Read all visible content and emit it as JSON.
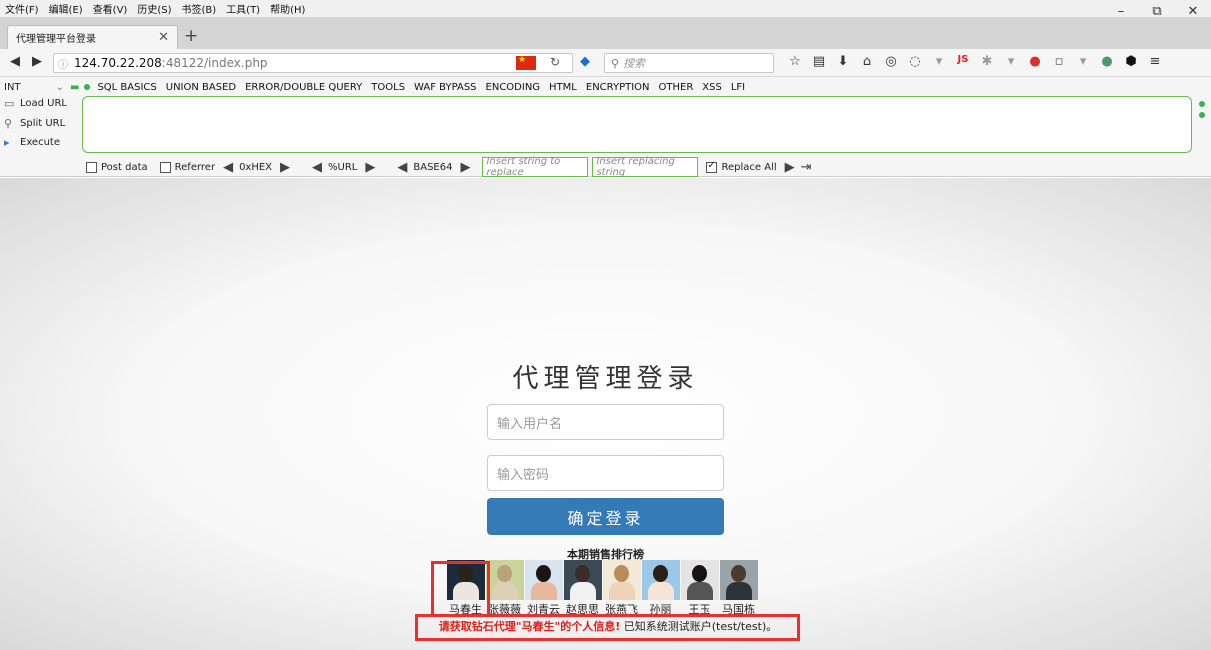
{
  "menubar": {
    "items": [
      "文件(F)",
      "编辑(E)",
      "查看(V)",
      "历史(S)",
      "书签(B)",
      "工具(T)",
      "帮助(H)"
    ]
  },
  "window_controls": [
    "–",
    "⧉",
    "✕"
  ],
  "tab": {
    "title": "代理管理平台登录",
    "close": "✕",
    "new_tab": "+"
  },
  "nav": {
    "url_host": "124.70.22.208",
    "url_path": ":48122/index.php",
    "search_placeholder": "搜索"
  },
  "hackbar": {
    "select_value": "INT",
    "menu_items": [
      "SQL BASICS",
      "UNION BASED",
      "ERROR/DOUBLE QUERY",
      "TOOLS",
      "WAF BYPASS",
      "ENCODING",
      "HTML",
      "ENCRYPTION",
      "OTHER",
      "XSS",
      "LFI"
    ],
    "load_url": "Load URL",
    "split_url": "Split URL",
    "execute": "Execute",
    "post_data": "Post data",
    "referrer": "Referrer",
    "hex": "0xHEX",
    "url": "%URL",
    "base64": "BASE64",
    "replace_input_placeholder": "Insert string to replace",
    "replacing_input_placeholder": "Insert replacing string",
    "replace_all": "Replace All"
  },
  "login": {
    "title": "代理管理登录",
    "username_placeholder": "输入用户名",
    "password_placeholder": "输入密码",
    "submit": "确定登录"
  },
  "ranking": {
    "title": "本期销售排行榜",
    "people": [
      {
        "name": "马春生",
        "bg": "#1e2a3a",
        "head": "#2b2220",
        "body": "#ece6e0"
      },
      {
        "name": "张薇薇",
        "bg": "#c9d39a",
        "head": "#b9a37e",
        "body": "#d9d2b6"
      },
      {
        "name": "刘青云",
        "bg": "#d7e3ee",
        "head": "#1b1614",
        "body": "#e7b89b"
      },
      {
        "name": "赵思思",
        "bg": "#3c4a56",
        "head": "#3a2c28",
        "body": "#f1f1f1"
      },
      {
        "name": "张燕飞",
        "bg": "#f2ead6",
        "head": "#b88c5a",
        "body": "#efd3b8"
      },
      {
        "name": "孙丽",
        "bg": "#9cc8e8",
        "head": "#2a1f1b",
        "body": "#f6e4d6"
      },
      {
        "name": "王玉",
        "bg": "#e4e4e4",
        "head": "#151313",
        "body": "#555555"
      },
      {
        "name": "马国栋",
        "bg": "#9aa4a8",
        "head": "#4a3a30",
        "body": "#2e3338"
      }
    ]
  },
  "notice": {
    "highlight": "请获取钻石代理\"马春生\"的个人信息!",
    "rest": " 已知系统测试账户(test/test)。"
  }
}
